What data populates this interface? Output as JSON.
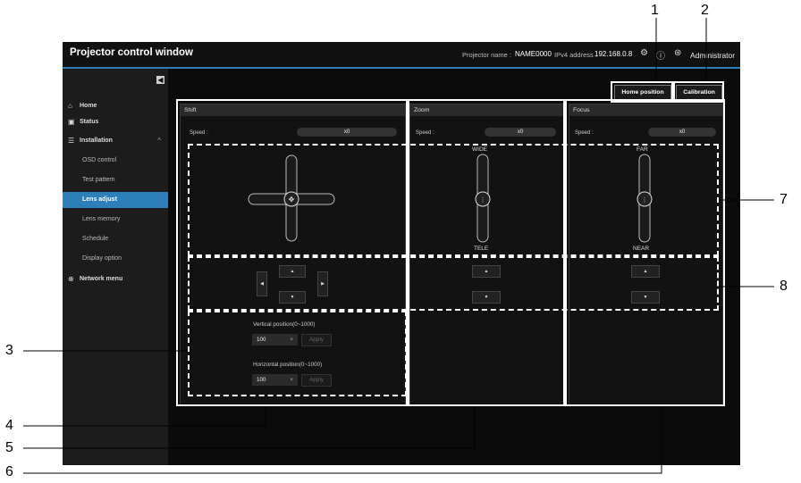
{
  "window": {
    "title": "Projector control window",
    "projector_name_label": "Projector name :",
    "projector_name": "NAME0000",
    "ipv4_label": "IPv4 address :",
    "ipv4": "192.168.0.8",
    "user": "Administrator"
  },
  "sidebar": {
    "items": [
      {
        "label": "Home",
        "icon": "home-icon"
      },
      {
        "label": "Status",
        "icon": "status-icon"
      },
      {
        "label": "Installation",
        "icon": "installation-icon"
      },
      {
        "label": "OSD control"
      },
      {
        "label": "Test pattern"
      },
      {
        "label": "Lens adjust"
      },
      {
        "label": "Lens memory"
      },
      {
        "label": "Schedule"
      },
      {
        "label": "Display option"
      },
      {
        "label": "Network menu",
        "icon": "globe-icon"
      }
    ]
  },
  "toolbar": {
    "home_position": "Home position",
    "calibration": "Calibration"
  },
  "panels": {
    "shift": {
      "title": "Shift",
      "speed_label": "Speed :",
      "speed": "x0"
    },
    "zoom": {
      "title": "Zoom",
      "speed_label": "Speed :",
      "speed": "x0",
      "top_label": "WIDE",
      "bottom_label": "TELE"
    },
    "focus": {
      "title": "Focus",
      "speed_label": "Speed :",
      "speed": "x0",
      "top_label": "FAR",
      "bottom_label": "NEAR"
    }
  },
  "position": {
    "vertical_label": "Vertical position(0~1000)",
    "vertical_value": "100",
    "horizontal_label": "Horizontal position(0~1000)",
    "horizontal_value": "100",
    "apply": "Apply",
    "clear": "×"
  },
  "callouts": [
    "1",
    "2",
    "3",
    "4",
    "5",
    "6",
    "7",
    "8"
  ],
  "accent_color": "#2c7fb8"
}
